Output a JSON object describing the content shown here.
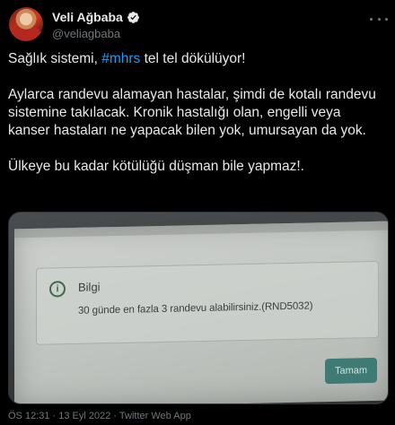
{
  "author": {
    "display_name": "Veli Ağbaba",
    "handle": "@veliagbaba"
  },
  "tweet": {
    "line1_before": "Sağlık sistemi, ",
    "hashtag": "#mhrs",
    "line1_after": " tel tel dökülüyor!",
    "paragraph2": "Aylarca randevu alamayan hastalar, şimdi de kotalı randevu sistemine takılacak. Kronik hastalığı olan, engelli veya kanser hastaları ne yapacak bilen yok, umursayan da yok.",
    "paragraph3": "Ülkeye bu kadar kötülüğü düşman bile yapmaz!."
  },
  "media": {
    "alert_title": "Bilgi",
    "alert_message": "30 günde en fazla 3 randevu alabilirsiniz.(RND5032)",
    "button_label": "Tamam"
  },
  "meta": {
    "timestamp": "ÖS 12:31 · 13 Eyl 2022 · Twitter Web App"
  },
  "colors": {
    "background": "#000000",
    "link": "#1d9bf0",
    "secondary_text": "#71767b",
    "verified_badge": "#e7e9ea"
  },
  "icons": {
    "verified": "verified-badge-icon",
    "more": "more-options-icon",
    "info": "info-icon"
  }
}
